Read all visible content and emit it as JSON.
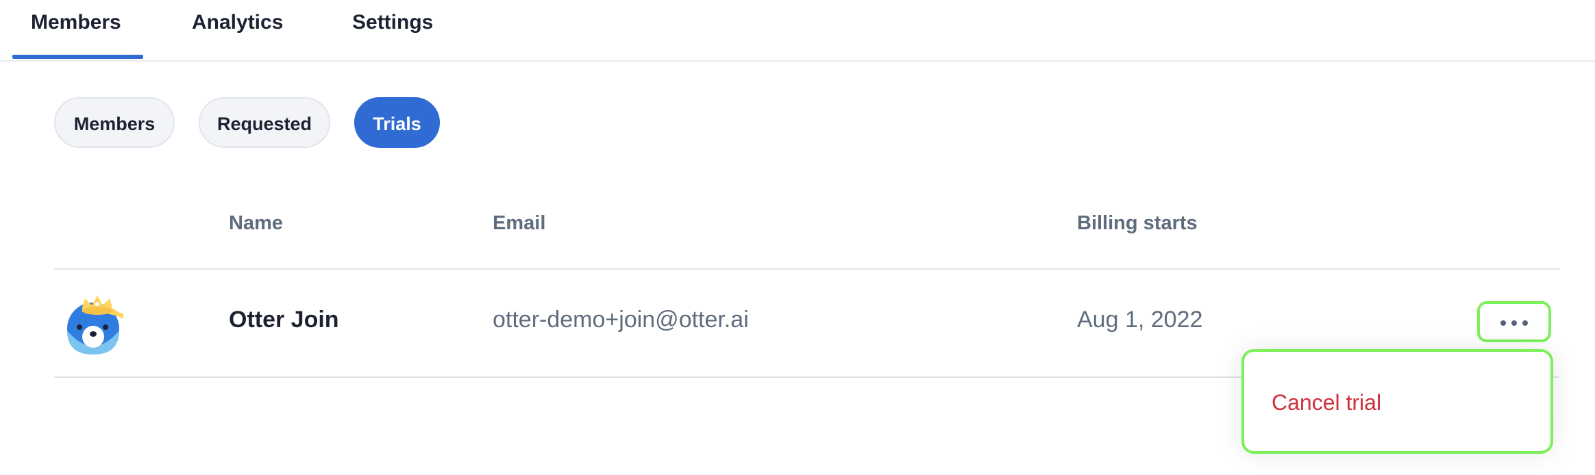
{
  "tabs": [
    {
      "label": "Members",
      "active": true
    },
    {
      "label": "Analytics",
      "active": false
    },
    {
      "label": "Settings",
      "active": false
    }
  ],
  "filters": [
    {
      "label": "Members",
      "active": false
    },
    {
      "label": "Requested",
      "active": false
    },
    {
      "label": "Trials",
      "active": true
    }
  ],
  "table": {
    "headers": {
      "name": "Name",
      "email": "Email",
      "billing": "Billing starts"
    },
    "rows": [
      {
        "avatar_icon": "otter-avatar-icon",
        "name": "Otter Join",
        "email": "otter-demo+join@otter.ai",
        "billing_starts": "Aug 1, 2022"
      }
    ]
  },
  "row_actions": {
    "more_icon": "more-horizontal-icon",
    "menu_items": [
      {
        "label": "Cancel trial",
        "color": "#cf2f3b"
      }
    ]
  },
  "colors": {
    "accent": "#2f6bd3",
    "danger": "#cf2f3b",
    "highlight": "#7cf05a"
  }
}
